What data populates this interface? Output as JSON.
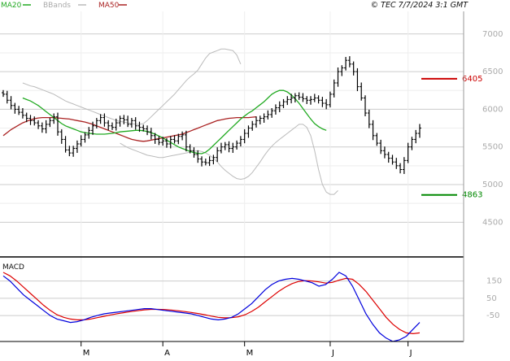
{
  "header": {
    "legend": [
      {
        "label": "MA20",
        "color": "#22aa22"
      },
      {
        "label": "BBands",
        "color": "#bbbbbb"
      },
      {
        "label": "MA50",
        "color": "#aa2222"
      }
    ],
    "copyright": "© TEC 7/7/2024 3:1 GMT"
  },
  "chart_data": [
    {
      "type": "ohlc",
      "title": "",
      "y_ticks": [
        4500,
        5000,
        5500,
        6000,
        6500,
        7000
      ],
      "ylim": [
        4050,
        7300
      ],
      "x_labels": [
        "M",
        "A",
        "M",
        "J",
        "J"
      ],
      "x_label_index": [
        20,
        41,
        62,
        84,
        104
      ],
      "n_bars": 108,
      "grid": true,
      "closes": [
        6200,
        6120,
        6050,
        6000,
        5960,
        5920,
        5880,
        5850,
        5820,
        5780,
        5740,
        5800,
        5850,
        5900,
        5700,
        5600,
        5460,
        5420,
        5480,
        5540,
        5600,
        5660,
        5720,
        5780,
        5850,
        5890,
        5820,
        5780,
        5760,
        5820,
        5880,
        5860,
        5800,
        5850,
        5780,
        5760,
        5740,
        5700,
        5650,
        5600,
        5560,
        5580,
        5540,
        5600,
        5580,
        5640,
        5660,
        5500,
        5450,
        5400,
        5340,
        5300,
        5290,
        5320,
        5360,
        5450,
        5500,
        5530,
        5480,
        5500,
        5550,
        5600,
        5680,
        5750,
        5800,
        5850,
        5880,
        5900,
        5930,
        5980,
        6020,
        6050,
        6100,
        6130,
        6150,
        6180,
        6160,
        6140,
        6120,
        6130,
        6150,
        6120,
        6080,
        6060,
        6200,
        6350,
        6500,
        6550,
        6650,
        6600,
        6500,
        6300,
        6150,
        5950,
        5800,
        5650,
        5550,
        5450,
        5400,
        5350,
        5300,
        5250,
        5200,
        5320,
        5500,
        5600,
        5680,
        5750
      ],
      "ma20": [
        6150,
        6130,
        6110,
        6080,
        6050,
        6010,
        5970,
        5930,
        5890,
        5850,
        5810,
        5780,
        5760,
        5740,
        5720,
        5700,
        5690,
        5680,
        5675,
        5670,
        5670,
        5670,
        5675,
        5680,
        5690,
        5700,
        5705,
        5710,
        5715,
        5720,
        5720,
        5715,
        5705,
        5690,
        5670,
        5645,
        5620,
        5590,
        5560,
        5530,
        5500,
        5480,
        5460,
        5440,
        5425,
        5415,
        5410,
        5430,
        5470,
        5520,
        5570,
        5620,
        5670,
        5720,
        5770,
        5820,
        5870,
        5910,
        5950,
        5980,
        6020,
        6060,
        6100,
        6150,
        6200,
        6230,
        6250,
        6250,
        6230,
        6190,
        6140,
        6080,
        6010,
        5940,
        5870,
        5810,
        5770,
        5740,
        5720
      ],
      "ma20_start": 5,
      "ma50": [
        5650,
        5690,
        5730,
        5760,
        5790,
        5820,
        5840,
        5860,
        5875,
        5885,
        5890,
        5890,
        5890,
        5890,
        5885,
        5880,
        5875,
        5870,
        5860,
        5850,
        5840,
        5830,
        5815,
        5800,
        5780,
        5760,
        5740,
        5720,
        5700,
        5680,
        5660,
        5640,
        5620,
        5600,
        5590,
        5580,
        5575,
        5580,
        5590,
        5600,
        5610,
        5620,
        5630,
        5640,
        5650,
        5660,
        5670,
        5690,
        5710,
        5730,
        5750,
        5770,
        5790,
        5810,
        5830,
        5850,
        5860,
        5870,
        5880,
        5885,
        5890,
        5890,
        5890,
        5890,
        5895,
        5900
      ],
      "ma50_start": 0,
      "bb_upper": [
        6350,
        6330,
        6310,
        6300,
        6280,
        6260,
        6240,
        6220,
        6200,
        6170,
        6140,
        6110,
        6090,
        6070,
        6050,
        6030,
        6010,
        5990,
        5970,
        5950,
        5930,
        5910,
        5890,
        5870,
        5850,
        5840,
        5830,
        5820,
        5810,
        5800,
        5800,
        5810,
        5850,
        5900,
        5950,
        6000,
        6050,
        6100,
        6150,
        6200,
        6260,
        6320,
        6380,
        6430,
        6470,
        6520,
        6600,
        6680,
        6740,
        6760,
        6780,
        6800,
        6800,
        6790,
        6780,
        6720,
        6600
      ],
      "bb_upper_start": 5,
      "bb_lower": [
        5550,
        5520,
        5490,
        5470,
        5450,
        5430,
        5410,
        5390,
        5380,
        5370,
        5360,
        5360,
        5370,
        5380,
        5390,
        5400,
        5410,
        5420,
        5430,
        5440,
        5450,
        5440,
        5420,
        5390,
        5350,
        5300,
        5240,
        5190,
        5150,
        5110,
        5080,
        5070,
        5080,
        5110,
        5160,
        5230,
        5300,
        5380,
        5450,
        5510,
        5560,
        5600,
        5640,
        5680,
        5720,
        5760,
        5800,
        5800,
        5760,
        5650,
        5450,
        5200,
        5000,
        4900,
        4870,
        4870,
        4920
      ],
      "bb_lower_start": 30,
      "levels": [
        {
          "value": 6405,
          "label": "6405",
          "color": "#cc0000"
        },
        {
          "value": 4863,
          "label": "4863",
          "color": "#008800"
        }
      ]
    },
    {
      "type": "line",
      "title": "MACD",
      "y_ticks": [
        150,
        50,
        -50
      ],
      "y_tick_labels": [
        "150",
        "50",
        "-50"
      ],
      "ylim": [
        -200,
        280
      ],
      "macd": [
        180,
        150,
        110,
        70,
        40,
        10,
        -20,
        -50,
        -70,
        -80,
        -90,
        -85,
        -75,
        -60,
        -50,
        -40,
        -35,
        -30,
        -25,
        -20,
        -15,
        -10,
        -10,
        -15,
        -20,
        -25,
        -30,
        -35,
        -40,
        -50,
        -60,
        -70,
        -75,
        -70,
        -60,
        -40,
        -10,
        20,
        60,
        100,
        130,
        150,
        160,
        165,
        160,
        150,
        140,
        120,
        130,
        160,
        200,
        180,
        120,
        40,
        -40,
        -100,
        -150,
        -180,
        -200,
        -190,
        -170,
        -130,
        -90
      ],
      "signal": [
        200,
        180,
        150,
        115,
        80,
        45,
        10,
        -20,
        -45,
        -60,
        -70,
        -75,
        -75,
        -70,
        -62,
        -54,
        -46,
        -39,
        -33,
        -27,
        -22,
        -17,
        -14,
        -14,
        -15,
        -18,
        -22,
        -27,
        -32,
        -38,
        -45,
        -53,
        -60,
        -63,
        -62,
        -57,
        -45,
        -26,
        -1,
        30,
        60,
        90,
        115,
        135,
        148,
        152,
        150,
        145,
        138,
        142,
        155,
        165,
        160,
        130,
        90,
        40,
        -10,
        -60,
        -100,
        -130,
        -150,
        -155,
        -150
      ],
      "macd_color": "#0000dd",
      "signal_color": "#dd0000"
    }
  ]
}
